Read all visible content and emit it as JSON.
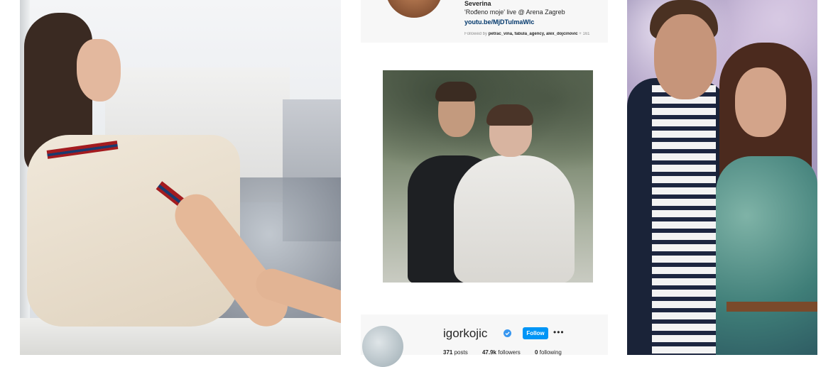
{
  "profile_top": {
    "name": "Severina",
    "bio": "'Rođeno moje' live @ Arena Zagreb",
    "link": "youtu.be/MjDTulmaWlc",
    "followed_by_prefix": "Followed by ",
    "followed_by_users": "petrac_vina, fabula_agency, alex_dojcinovic",
    "followed_by_suffix": " + 161"
  },
  "profile_bottom": {
    "username": "igorkojic",
    "follow_label": "Follow",
    "more_label": "•••",
    "verified_icon": "verified-badge-icon",
    "stats": {
      "posts_value": "371",
      "posts_label": "posts",
      "followers_value": "47.9k",
      "followers_label": "followers",
      "following_value": "0",
      "following_label": "following"
    }
  },
  "colors": {
    "follow_button": "#0095f6",
    "link": "#00376b",
    "verified": "#3897f0"
  }
}
